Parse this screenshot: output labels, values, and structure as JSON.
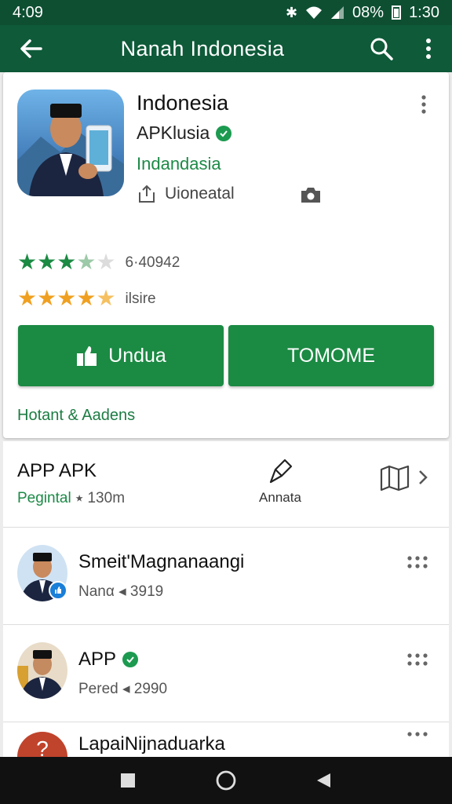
{
  "status_bar": {
    "time": "4:09",
    "battery": "08%",
    "clock": "1:30"
  },
  "app_bar": {
    "title": "Nanah Indonesia"
  },
  "app": {
    "name": "Indonesia",
    "developer": "APKlusia",
    "category": "Indandasia",
    "share_label": "Uioneatal"
  },
  "ratings": [
    {
      "stars": 3.5,
      "color": "#1b8a43",
      "label": "6·40942"
    },
    {
      "stars": 4.5,
      "color": "#f0a020",
      "label": "ilsire"
    }
  ],
  "buttons": {
    "install": "Undua",
    "second": "TOMOME"
  },
  "footer_link": "Hotant & Aadens",
  "app_row": {
    "title": "APP APK",
    "subtitle_green": "Pegintal",
    "subtitle_gray": " ⭑ 130m",
    "annotate_label": "Annata"
  },
  "people": [
    {
      "name": "Smeit'Magnanaangi",
      "sub": "Nanα ◂ 3919",
      "verified": false
    },
    {
      "name": "APP",
      "sub": "Pered ◂ 2990",
      "verified": true
    }
  ],
  "partial_row": {
    "name": "LapaiNijnaduarka",
    "avatar_letter": "?"
  },
  "colors": {
    "primary_dark": "#0e4f32",
    "primary": "#0e5a39",
    "accent": "#1b8a43",
    "star_gold": "#f0a020"
  }
}
